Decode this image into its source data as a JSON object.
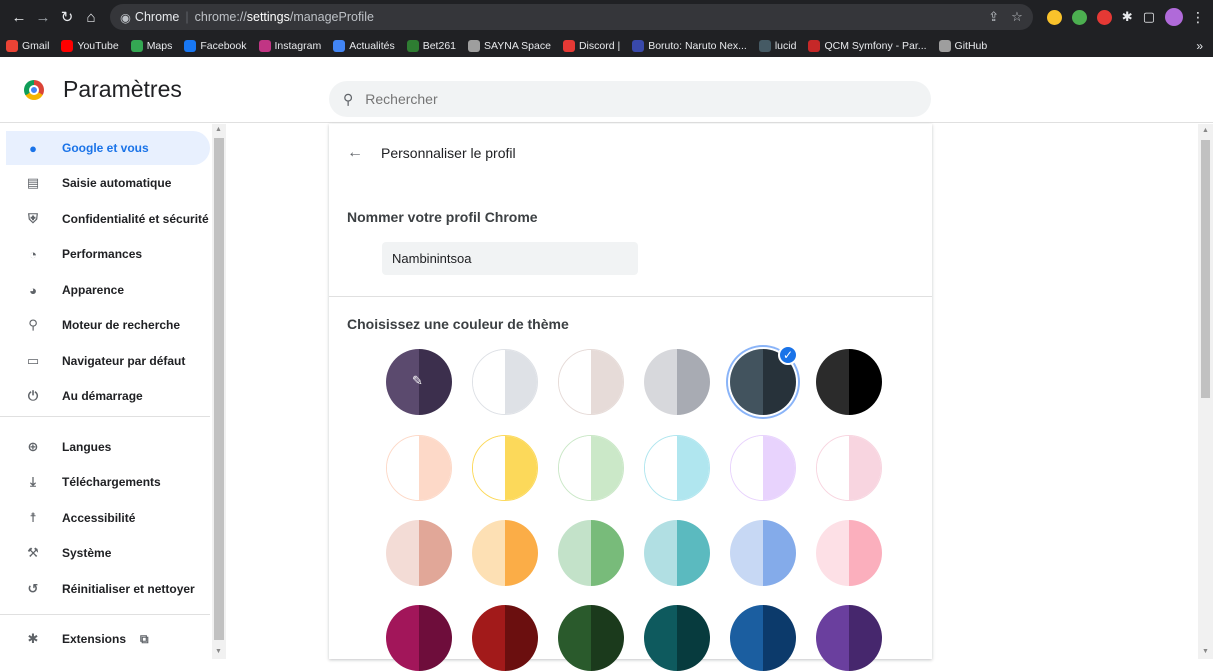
{
  "browser": {
    "site_chip": "Chrome",
    "url_prefix": "chrome://",
    "url_bold": "settings",
    "url_suffix": "/manageProfile"
  },
  "bookmarks": [
    {
      "label": "Gmail",
      "color": "#ea4335"
    },
    {
      "label": "YouTube",
      "color": "#ff0000"
    },
    {
      "label": "Maps",
      "color": "#34a853"
    },
    {
      "label": "Facebook",
      "color": "#1877f2"
    },
    {
      "label": "Instagram",
      "color": "#c13584"
    },
    {
      "label": "Actualités",
      "color": "#4285f4"
    },
    {
      "label": "Bet261",
      "color": "#2e7d32"
    },
    {
      "label": "SAYNA Space",
      "color": "#9e9e9e"
    },
    {
      "label": "Discord |",
      "color": "#e53935"
    },
    {
      "label": "Boruto: Naruto Nex...",
      "color": "#3949ab"
    },
    {
      "label": "lucid",
      "color": "#455a64"
    },
    {
      "label": "QCM Symfony - Par...",
      "color": "#c62828"
    },
    {
      "label": "GitHub",
      "color": "#9e9e9e"
    }
  ],
  "settings": {
    "title": "Paramètres",
    "search_placeholder": "Rechercher"
  },
  "sidebar": {
    "items": [
      {
        "label": "Google et vous",
        "icon": "person-icon",
        "active": true
      },
      {
        "label": "Saisie automatique",
        "icon": "clipboard-icon"
      },
      {
        "label": "Confidentialité et sécurité",
        "icon": "shield-icon"
      },
      {
        "label": "Performances",
        "icon": "gauge-icon"
      },
      {
        "label": "Apparence",
        "icon": "palette-icon"
      },
      {
        "label": "Moteur de recherche",
        "icon": "search-icon"
      },
      {
        "label": "Navigateur par défaut",
        "icon": "browser-icon"
      },
      {
        "label": "Au démarrage",
        "icon": "power-icon"
      },
      {
        "label": "Langues",
        "icon": "globe-icon"
      },
      {
        "label": "Téléchargements",
        "icon": "download-icon"
      },
      {
        "label": "Accessibilité",
        "icon": "accessibility-icon"
      },
      {
        "label": "Système",
        "icon": "wrench-icon"
      },
      {
        "label": "Réinitialiser et nettoyer",
        "icon": "reset-icon"
      },
      {
        "label": "Extensions",
        "icon": "puzzle-icon"
      }
    ]
  },
  "profile": {
    "back_label": "Personnaliser le profil",
    "name_heading": "Nommer votre profil Chrome",
    "name_value": "Nambinintsoa",
    "theme_heading": "Choisissez une couleur de thème",
    "selected_theme": 4,
    "themes": [
      [
        "#5b4a6e",
        "#3c2f4d"
      ],
      [
        "#ffffff",
        "#dee1e6"
      ],
      [
        "#ffffff",
        "#e6dbd8"
      ],
      [
        "#d7d8dc",
        "#a8abb3"
      ],
      [
        "#42535e",
        "#27323a"
      ],
      [
        "#2b2b2b",
        "#000000"
      ],
      [
        "#ffffff",
        "#fdd9c8"
      ],
      [
        "#ffffff",
        "#fcd95a"
      ],
      [
        "#ffffff",
        "#cbe8c8"
      ],
      [
        "#ffffff",
        "#b0e6ef"
      ],
      [
        "#ffffff",
        "#e8d3fd"
      ],
      [
        "#ffffff",
        "#f8d5e0"
      ],
      [
        "#f3dcd6",
        "#e1a798"
      ],
      [
        "#fde0b4",
        "#fbad47"
      ],
      [
        "#c3e2c9",
        "#78bb7a"
      ],
      [
        "#b1dfe3",
        "#5bbabf"
      ],
      [
        "#c7d8f4",
        "#84abea"
      ],
      [
        "#fde0e6",
        "#fbafbd"
      ],
      [
        "#a2165a",
        "#6e0d3b"
      ],
      [
        "#a21a1a",
        "#6b0f0f"
      ],
      [
        "#2a5a2c",
        "#1b3a1c"
      ],
      [
        "#0e5a5e",
        "#073b3e"
      ],
      [
        "#1b5ea0",
        "#0c3a6b"
      ],
      [
        "#6a3f9e",
        "#46276d"
      ]
    ]
  }
}
